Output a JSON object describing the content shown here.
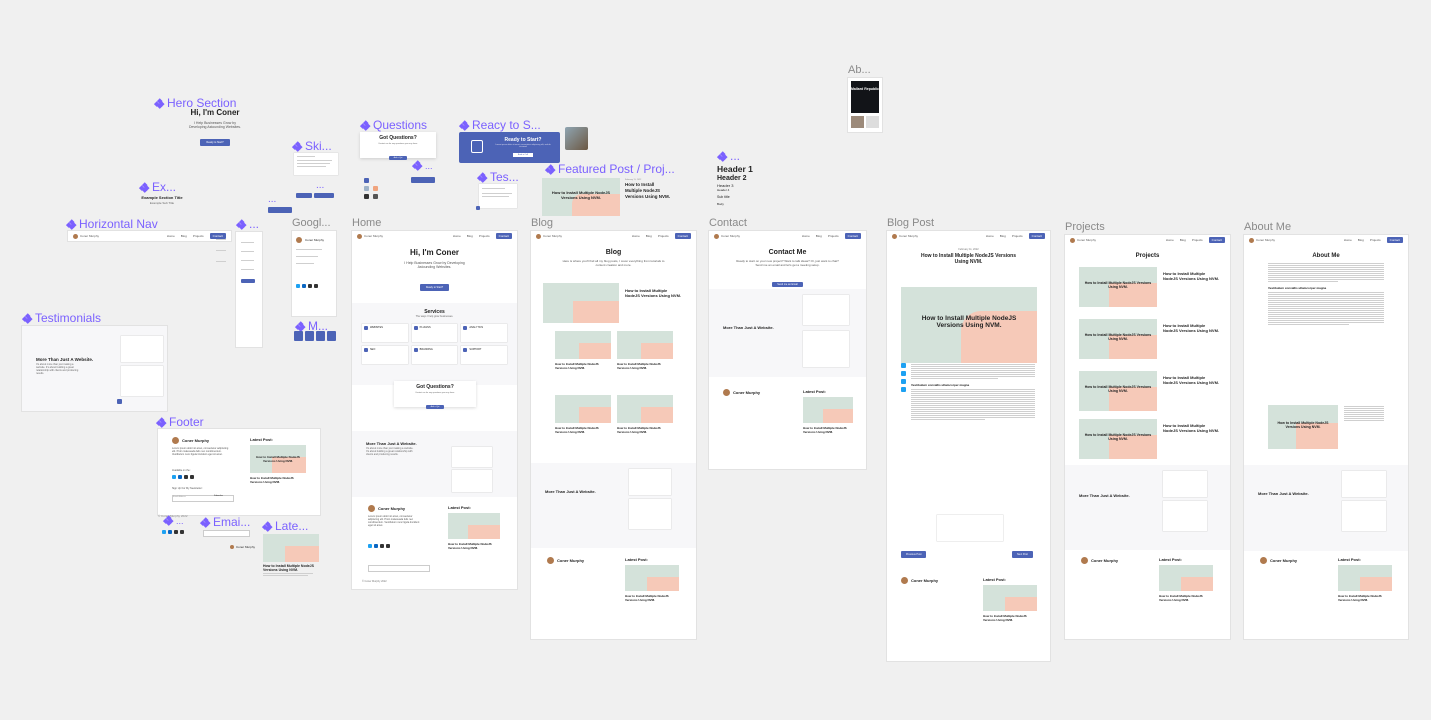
{
  "canvas": {
    "background": "#f0f0f0",
    "accent": "#4c63b6",
    "component_color": "#7b61ff",
    "pink": "#f6c9b8",
    "green": "#d4e2da"
  },
  "component_labels": {
    "hero": "Hero Section",
    "questions": "Questions",
    "ready": "Reacy to S...",
    "featured": "Featured Post / Proj...",
    "testimonial_small": "Tes...",
    "skills": "Ski...",
    "ex": "Ex...",
    "horizontal_nav": "Horizontal Nav",
    "vert_nav": "...",
    "google": "Googl...",
    "m": "M...",
    "testimonials": "Testimonials",
    "footer": "Footer",
    "email": "Emai...",
    "latest": "Late...",
    "tiny1": "...",
    "tiny2": "...",
    "headers": "..."
  },
  "frame_labels": {
    "home": "Home",
    "blog": "Blog",
    "contact": "Contact",
    "blog_post": "Blog Post",
    "projects": "Projects",
    "about": "About Me",
    "ab": "Ab..."
  },
  "hero": {
    "title": "Hi, I'm Coner",
    "subtitle": "I Help Businesses Grow by Developing Astounding Websites.",
    "cta": "Ready to Start?"
  },
  "ex": {
    "title": "Example Section Title",
    "sub": "Example Sub Title"
  },
  "questions": {
    "title": "Got Questions?",
    "text": "Contact me for any questions you may have.",
    "cta": "Ask a Qst"
  },
  "ready": {
    "title": "Ready to Start?",
    "text": "Lorem ipsum dolor sit amet, consectetur adipiscing elit, sed do eiusmod",
    "cta": "Book a Call"
  },
  "featured": {
    "post_title": "How to Install Multiple NodeJS Versions Using NVM.",
    "date": "February 11, 2022"
  },
  "headers": {
    "h1": "Header 1",
    "h2": "Header 2",
    "h3": "Header 3",
    "h4": "Header 4",
    "sub": "Sub title",
    "body": "Body"
  },
  "ab_thumb": {
    "title": "Mallard Republic"
  },
  "nav": {
    "name": "Coner Murphy",
    "links": [
      "Home",
      "Blog",
      "Projects",
      "Contact"
    ]
  },
  "home": {
    "hero_title": "Hi, I'm Coner",
    "hero_sub": "I Help Businesses Grow by Developing Astounding Websites.",
    "hero_cta": "Ready to Start?",
    "services_title": "Services",
    "services_sub": "The ways I help grow businesses.",
    "services": [
      "WEBSITES",
      "PLUGINS",
      "ANALYTICS",
      "SEO",
      "BRANDING",
      "SUPPORT"
    ],
    "questions_title": "Got Questions?",
    "questions_text": "Contact me for any questions you may have.",
    "questions_cta": "Ask a Qst",
    "testimonial_title": "More Than Just A Website.",
    "testimonial_text": "It's about more than just making a website. It's about building a great relationship with clients and producing results."
  },
  "blog": {
    "title": "Blog",
    "sub": "Here is where you'll find all my blog posts, I cover everything from tutorials to content creation and more.",
    "post_title": "How to Install Multiple NodeJS Versions Using NVM."
  },
  "contact": {
    "title": "Contact Me",
    "sub": "Ready to start on your new project? Want to talk ideas? Or, just want to chat? Send me an email and let's get a meeting setup.",
    "cta": "Send me an Email",
    "testimonial_title": "More Than Just A Website."
  },
  "blog_post": {
    "date": "February 11, 2022",
    "title": "How to Install Multiple NodeJS Versions Using NVM.",
    "hero_text": "How to Install Multiple NodeJS Versions Using NVM.",
    "section": "Vestibulum convallis ullamcorper magna",
    "prev": "Previous Post",
    "next": "Next Post"
  },
  "projects": {
    "title": "Projects",
    "post_title": "How to Install Multiple NodeJS Versions Using NVM.",
    "testimonial_title": "More Than Just A Website."
  },
  "about": {
    "title": "About Me",
    "section1": "Vestibulum convallis ullamcorper magna",
    "testimonial_title": "More Than Just A Website."
  },
  "footer": {
    "name": "Coner Murphy",
    "about": "Lorem ipsum dolor sit amet, consectetur adipiscing elit. Proin malesuada felis nec condimentum. Vestibulum nunc ligula tincidunt eget sit amet.",
    "latest_label": "Latest Post:",
    "available": "Available on the:",
    "newsletter": "Sign Up For My Newsletter:",
    "email_placeholder": "Email Address",
    "subscribe": "Subscribe",
    "post_title": "How to Install Multiple NodeJS Versions Using NVM.",
    "copyright": "© Coner Murphy 2022"
  },
  "testimonials": {
    "title": "More Than Just A Website.",
    "text": "It's about more than just making a website. It's about building a great relationship with clients and producing results."
  }
}
